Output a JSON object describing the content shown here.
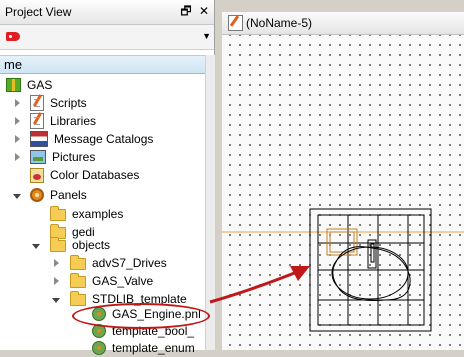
{
  "project_view": {
    "title": "Project View",
    "float_button": "🗗",
    "close_button": "✕",
    "column_header": "me",
    "tree": [
      {
        "label": "GAS",
        "icon": "gift-icon"
      },
      {
        "label": "Scripts",
        "icon": "script-icon"
      },
      {
        "label": "Libraries",
        "icon": "library-icon"
      },
      {
        "label": "Message Catalogs",
        "icon": "message-catalog-icon"
      },
      {
        "label": "Pictures",
        "icon": "picture-icon"
      },
      {
        "label": "Color Databases",
        "icon": "color-database-icon"
      },
      {
        "label": "Panels",
        "icon": "panels-icon"
      },
      {
        "label": "examples",
        "icon": "folder-icon"
      },
      {
        "label": "gedi",
        "icon": "folder-icon"
      },
      {
        "label": "objects",
        "icon": "folder-icon"
      },
      {
        "label": "advS7_Drives",
        "icon": "folder-icon"
      },
      {
        "label": "GAS_Valve",
        "icon": "folder-icon"
      },
      {
        "label": "STDLIB_template",
        "icon": "folder-icon"
      },
      {
        "label": "GAS_Engine.pnl",
        "icon": "panel-file-icon"
      },
      {
        "label": "template_bool_",
        "icon": "panel-file-icon"
      },
      {
        "label": "template_enum",
        "icon": "panel-file-icon"
      }
    ]
  },
  "editor": {
    "title": "(NoName-5)"
  },
  "colors": {
    "annotation_red": "#c01818",
    "guide_orange": "#f0a040",
    "header_blue": "#cfe4f3"
  }
}
